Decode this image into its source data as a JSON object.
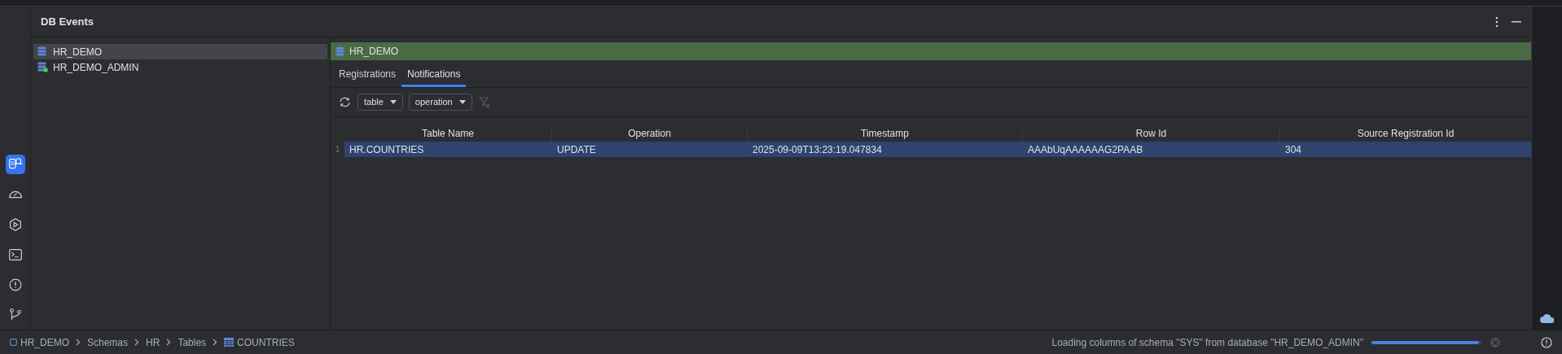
{
  "panel": {
    "title": "DB Events"
  },
  "connections": [
    {
      "name": "HR_DEMO",
      "selected": true,
      "connected": false
    },
    {
      "name": "HR_DEMO_ADMIN",
      "selected": false,
      "connected": true
    }
  ],
  "header": {
    "title": "HR_DEMO"
  },
  "tabs": [
    {
      "label": "Registrations",
      "selected": false
    },
    {
      "label": "Notifications",
      "selected": true
    }
  ],
  "filters": [
    {
      "label": "table"
    },
    {
      "label": "operation"
    }
  ],
  "table": {
    "columns": [
      "Table Name",
      "Operation",
      "Timestamp",
      "Row Id",
      "Source Registration Id"
    ],
    "rows": [
      {
        "number": "1",
        "selected": true,
        "cells": [
          "HR.COUNTRIES",
          "UPDATE",
          "2025-09-09T13:23:19.047834",
          "AAAbUqAAAAAAG2PAAB",
          "304"
        ]
      }
    ]
  },
  "sidebar_tools": [
    {
      "kind": "events",
      "selected": true
    },
    {
      "kind": "gauge",
      "selected": false
    },
    {
      "kind": "run",
      "selected": false
    },
    {
      "kind": "terminal",
      "selected": false
    },
    {
      "kind": "problems",
      "selected": false
    },
    {
      "kind": "git",
      "selected": false
    }
  ],
  "breadcrumbs": [
    {
      "kind": "connection",
      "label": "HR_DEMO"
    },
    {
      "kind": "plain",
      "label": "Schemas"
    },
    {
      "kind": "plain",
      "label": "HR"
    },
    {
      "kind": "plain",
      "label": "Tables"
    },
    {
      "kind": "table",
      "label": "COUNTRIES"
    }
  ],
  "status": {
    "message": "Loading columns of schema \"SYS\" from database \"HR_DEMO_ADMIN\"",
    "level": 0.97
  }
}
